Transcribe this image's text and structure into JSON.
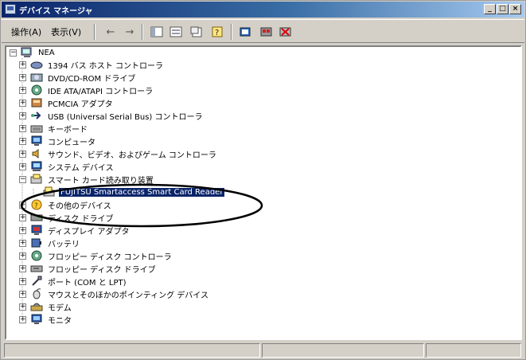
{
  "window": {
    "title": "デバイス マネージャ",
    "caption_buttons": [
      {
        "name": "minimize",
        "glyph": "_"
      },
      {
        "name": "maximize",
        "glyph": "□"
      },
      {
        "name": "close",
        "glyph": "×"
      }
    ]
  },
  "toolbar": {
    "menus": [
      {
        "label": "操作(A)"
      },
      {
        "label": "表示(V)"
      }
    ],
    "buttons": [
      {
        "icon": "back-arrow-icon",
        "glyph": "←"
      },
      {
        "icon": "forward-arrow-icon",
        "glyph": "→"
      },
      {
        "icon": "console-tree-icon"
      },
      {
        "icon": "view-list-icon"
      },
      {
        "icon": "properties-icon"
      },
      {
        "icon": "help-icon",
        "glyph": "?"
      },
      {
        "icon": "scan-hardware-icon"
      },
      {
        "icon": "update-driver-icon"
      },
      {
        "icon": "uninstall-icon"
      }
    ]
  },
  "tree": {
    "root": {
      "label": "NEA",
      "expander": "−",
      "icon": "computer-icon"
    },
    "items": [
      {
        "label": "1394 バス ホスト コントローラ",
        "expander": "+",
        "icon": "bus-controller-icon"
      },
      {
        "label": "DVD/CD-ROM ドライブ",
        "expander": "+",
        "icon": "cdrom-drive-icon"
      },
      {
        "label": "IDE ATA/ATAPI コントローラ",
        "expander": "+",
        "icon": "ide-controller-icon"
      },
      {
        "label": "PCMCIA アダプタ",
        "expander": "+",
        "icon": "pcmcia-adapter-icon"
      },
      {
        "label": "USB (Universal Serial Bus) コントローラ",
        "expander": "+",
        "icon": "usb-controller-icon"
      },
      {
        "label": "キーボード",
        "expander": "+",
        "icon": "keyboard-icon"
      },
      {
        "label": "コンピュータ",
        "expander": "+",
        "icon": "computer-monitor-icon"
      },
      {
        "label": "サウンド、ビデオ、およびゲーム コントローラ",
        "expander": "+",
        "icon": "sound-icon"
      },
      {
        "label": "システム デバイス",
        "expander": "+",
        "icon": "system-device-icon"
      },
      {
        "label": "スマート カード読み取り装置",
        "expander": "−",
        "icon": "smartcard-reader-icon"
      },
      {
        "label": "FUJITSU Smartaccess Smart Card Reader",
        "expander": "",
        "icon": "smartcard-device-icon",
        "selected": true,
        "child": true
      },
      {
        "label": "その他のデバイス",
        "expander": "+",
        "icon": "other-device-icon"
      },
      {
        "label": "ディスク ドライブ",
        "expander": "+",
        "icon": "disk-drive-icon"
      },
      {
        "label": "ディスプレイ アダプタ",
        "expander": "+",
        "icon": "display-adapter-icon"
      },
      {
        "label": "バッテリ",
        "expander": "+",
        "icon": "battery-icon"
      },
      {
        "label": "フロッピー ディスク コントローラ",
        "expander": "+",
        "icon": "floppy-controller-icon"
      },
      {
        "label": "フロッピー ディスク ドライブ",
        "expander": "+",
        "icon": "floppy-drive-icon"
      },
      {
        "label": "ポート (COM と LPT)",
        "expander": "+",
        "icon": "port-icon"
      },
      {
        "label": "マウスとそのほかのポインティング デバイス",
        "expander": "+",
        "icon": "mouse-icon"
      },
      {
        "label": "モデム",
        "expander": "+",
        "icon": "modem-icon"
      },
      {
        "label": "モニタ",
        "expander": "+",
        "icon": "monitor-icon"
      }
    ]
  },
  "colors": {
    "selection": "#0a246a",
    "title_gradient_start": "#0a246a",
    "title_gradient_end": "#a6caf0",
    "annotation_ellipse": "#000000"
  }
}
